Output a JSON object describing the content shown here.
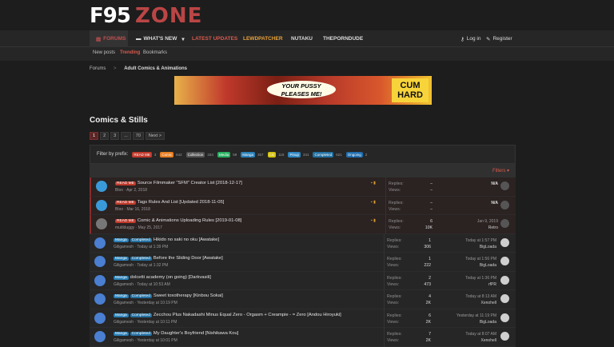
{
  "logo": {
    "part1": "F95",
    "part2": "ZONE"
  },
  "nav": {
    "forums": "FORUMS",
    "whats_new": "WHAT'S NEW",
    "latest_updates": "LATEST UPDATES",
    "lewdpatcher": "LEWDPATCHER",
    "nutaku": "NUTAKU",
    "theporndude": "THEPORNDUDE",
    "login": "Log in",
    "register": "Register"
  },
  "subnav": {
    "new_posts": "New posts",
    "trending": "Trending",
    "bookmarks": "Bookmarks"
  },
  "breadcrumb": {
    "forums": "Forums",
    "sep": ">",
    "current": "Adult Comics & Animations"
  },
  "banner": {
    "line1": "YOUR PUSSY",
    "line2": "PLEASES ME!",
    "brand1": "CUM",
    "brand2": "HARD"
  },
  "page_title": "Comics & Stills",
  "pager": [
    "1",
    "2",
    "3",
    "...",
    "70",
    "Next >"
  ],
  "prefix_label": "Filter by prefix:",
  "prefixes": [
    {
      "name": "READ ME",
      "count": "3",
      "color": "#c0392b"
    },
    {
      "name": "Comic",
      "count": "642",
      "color": "#e67e22"
    },
    {
      "name": "Collection",
      "count": "334",
      "color": "#555555"
    },
    {
      "name": "Media",
      "count": "59",
      "color": "#27ae60"
    },
    {
      "name": "Manga",
      "count": "357",
      "color": "#2980b9"
    },
    {
      "name": "CG",
      "count": "118",
      "color": "#d4c20f"
    },
    {
      "name": "Pinup",
      "count": "341",
      "color": "#2e86c1"
    },
    {
      "name": "Completed",
      "count": "621",
      "color": "#2471a3"
    },
    {
      "name": "Ongoing",
      "count": "2",
      "color": "#1f6dad"
    }
  ],
  "filters_label": "Filters ▾",
  "threads": [
    {
      "tags": [
        "READ ME"
      ],
      "title": "Source Filmmaker \"SFM\" Creator List [2018-12-17]",
      "author": "Bloo",
      "date": "Apr 2, 2018",
      "replies": "–",
      "views": "–",
      "last_date": "N/A",
      "last_user": "",
      "sticky": true,
      "av": "#3a9ad9"
    },
    {
      "tags": [
        "READ ME"
      ],
      "title": "Tags Rules And List [Updated 2018-11-05]",
      "author": "Bloo",
      "date": "Mar 16, 2018",
      "replies": "–",
      "views": "–",
      "last_date": "N/A",
      "last_user": "",
      "sticky": true,
      "av": "#3a9ad9"
    },
    {
      "tags": [
        "READ ME"
      ],
      "title": "Comic & Animations Uploading Rules [2019-01-08]",
      "author": "mutilduggy",
      "date": "May 25, 2017",
      "replies": "6",
      "views": "10K",
      "last_date": "Jan 9, 2019",
      "last_user": "Retro",
      "sticky": true,
      "av": "#777777"
    },
    {
      "tags": [
        "Manga",
        "Completed"
      ],
      "title": "Hikido no saki no oku [Awatake]",
      "author": "Giligamesh",
      "date": "Today at 1:39 PM",
      "replies": "1",
      "views": "306",
      "last_date": "Today at 1:57 PM",
      "last_user": "BigLoada",
      "sticky": false,
      "av": "#4a7fd1"
    },
    {
      "tags": [
        "Manga",
        "Completed"
      ],
      "title": "Before the Sliding Door [Awatake]",
      "author": "Giligamesh",
      "date": "Today at 1:32 PM",
      "replies": "1",
      "views": "222",
      "last_date": "Today at 1:56 PM",
      "last_user": "BigLoada",
      "sticky": false,
      "av": "#4a7fd1"
    },
    {
      "tags": [
        "Manga"
      ],
      "title": "dolcetti academy (on going) [Darkvasili]",
      "author": "Giligamesh",
      "date": "Today at 10:53 AM",
      "replies": "2",
      "views": "473",
      "last_date": "Today at 1:36 PM",
      "last_user": "rfPR",
      "sticky": false,
      "av": "#4a7fd1"
    },
    {
      "tags": [
        "Manga",
        "Completed"
      ],
      "title": "Sweet toxotherapy [Kinbou Sokai]",
      "author": "Giligamesh",
      "date": "Yesterday at 10:19 PM",
      "replies": "4",
      "views": "2K",
      "last_date": "Today at 8:13 AM",
      "last_user": "Xenohell",
      "sticky": false,
      "av": "#4a7fd1"
    },
    {
      "tags": [
        "Manga",
        "Completed"
      ],
      "title": "Zecchou Plus Nakadashi Minus Equal Zero - Orgasm + Creampie - = Zero [Andou Hiroyuki]",
      "author": "Giligamesh",
      "date": "Yesterday at 10:11 PM",
      "replies": "6",
      "views": "2K",
      "last_date": "Yesterday at 11:19 PM",
      "last_user": "BigLoada",
      "sticky": false,
      "av": "#4a7fd1"
    },
    {
      "tags": [
        "Manga",
        "Completed"
      ],
      "title": "My Daughter's Boyfriend [Nishikawa Kou]",
      "author": "Giligamesh",
      "date": "Yesterday at 10:01 PM",
      "replies": "7",
      "views": "2K",
      "last_date": "Today at 8:07 AM",
      "last_user": "Xenohell",
      "sticky": false,
      "av": "#4a7fd1"
    }
  ],
  "labels": {
    "replies": "Replies:",
    "views": "Views:"
  }
}
